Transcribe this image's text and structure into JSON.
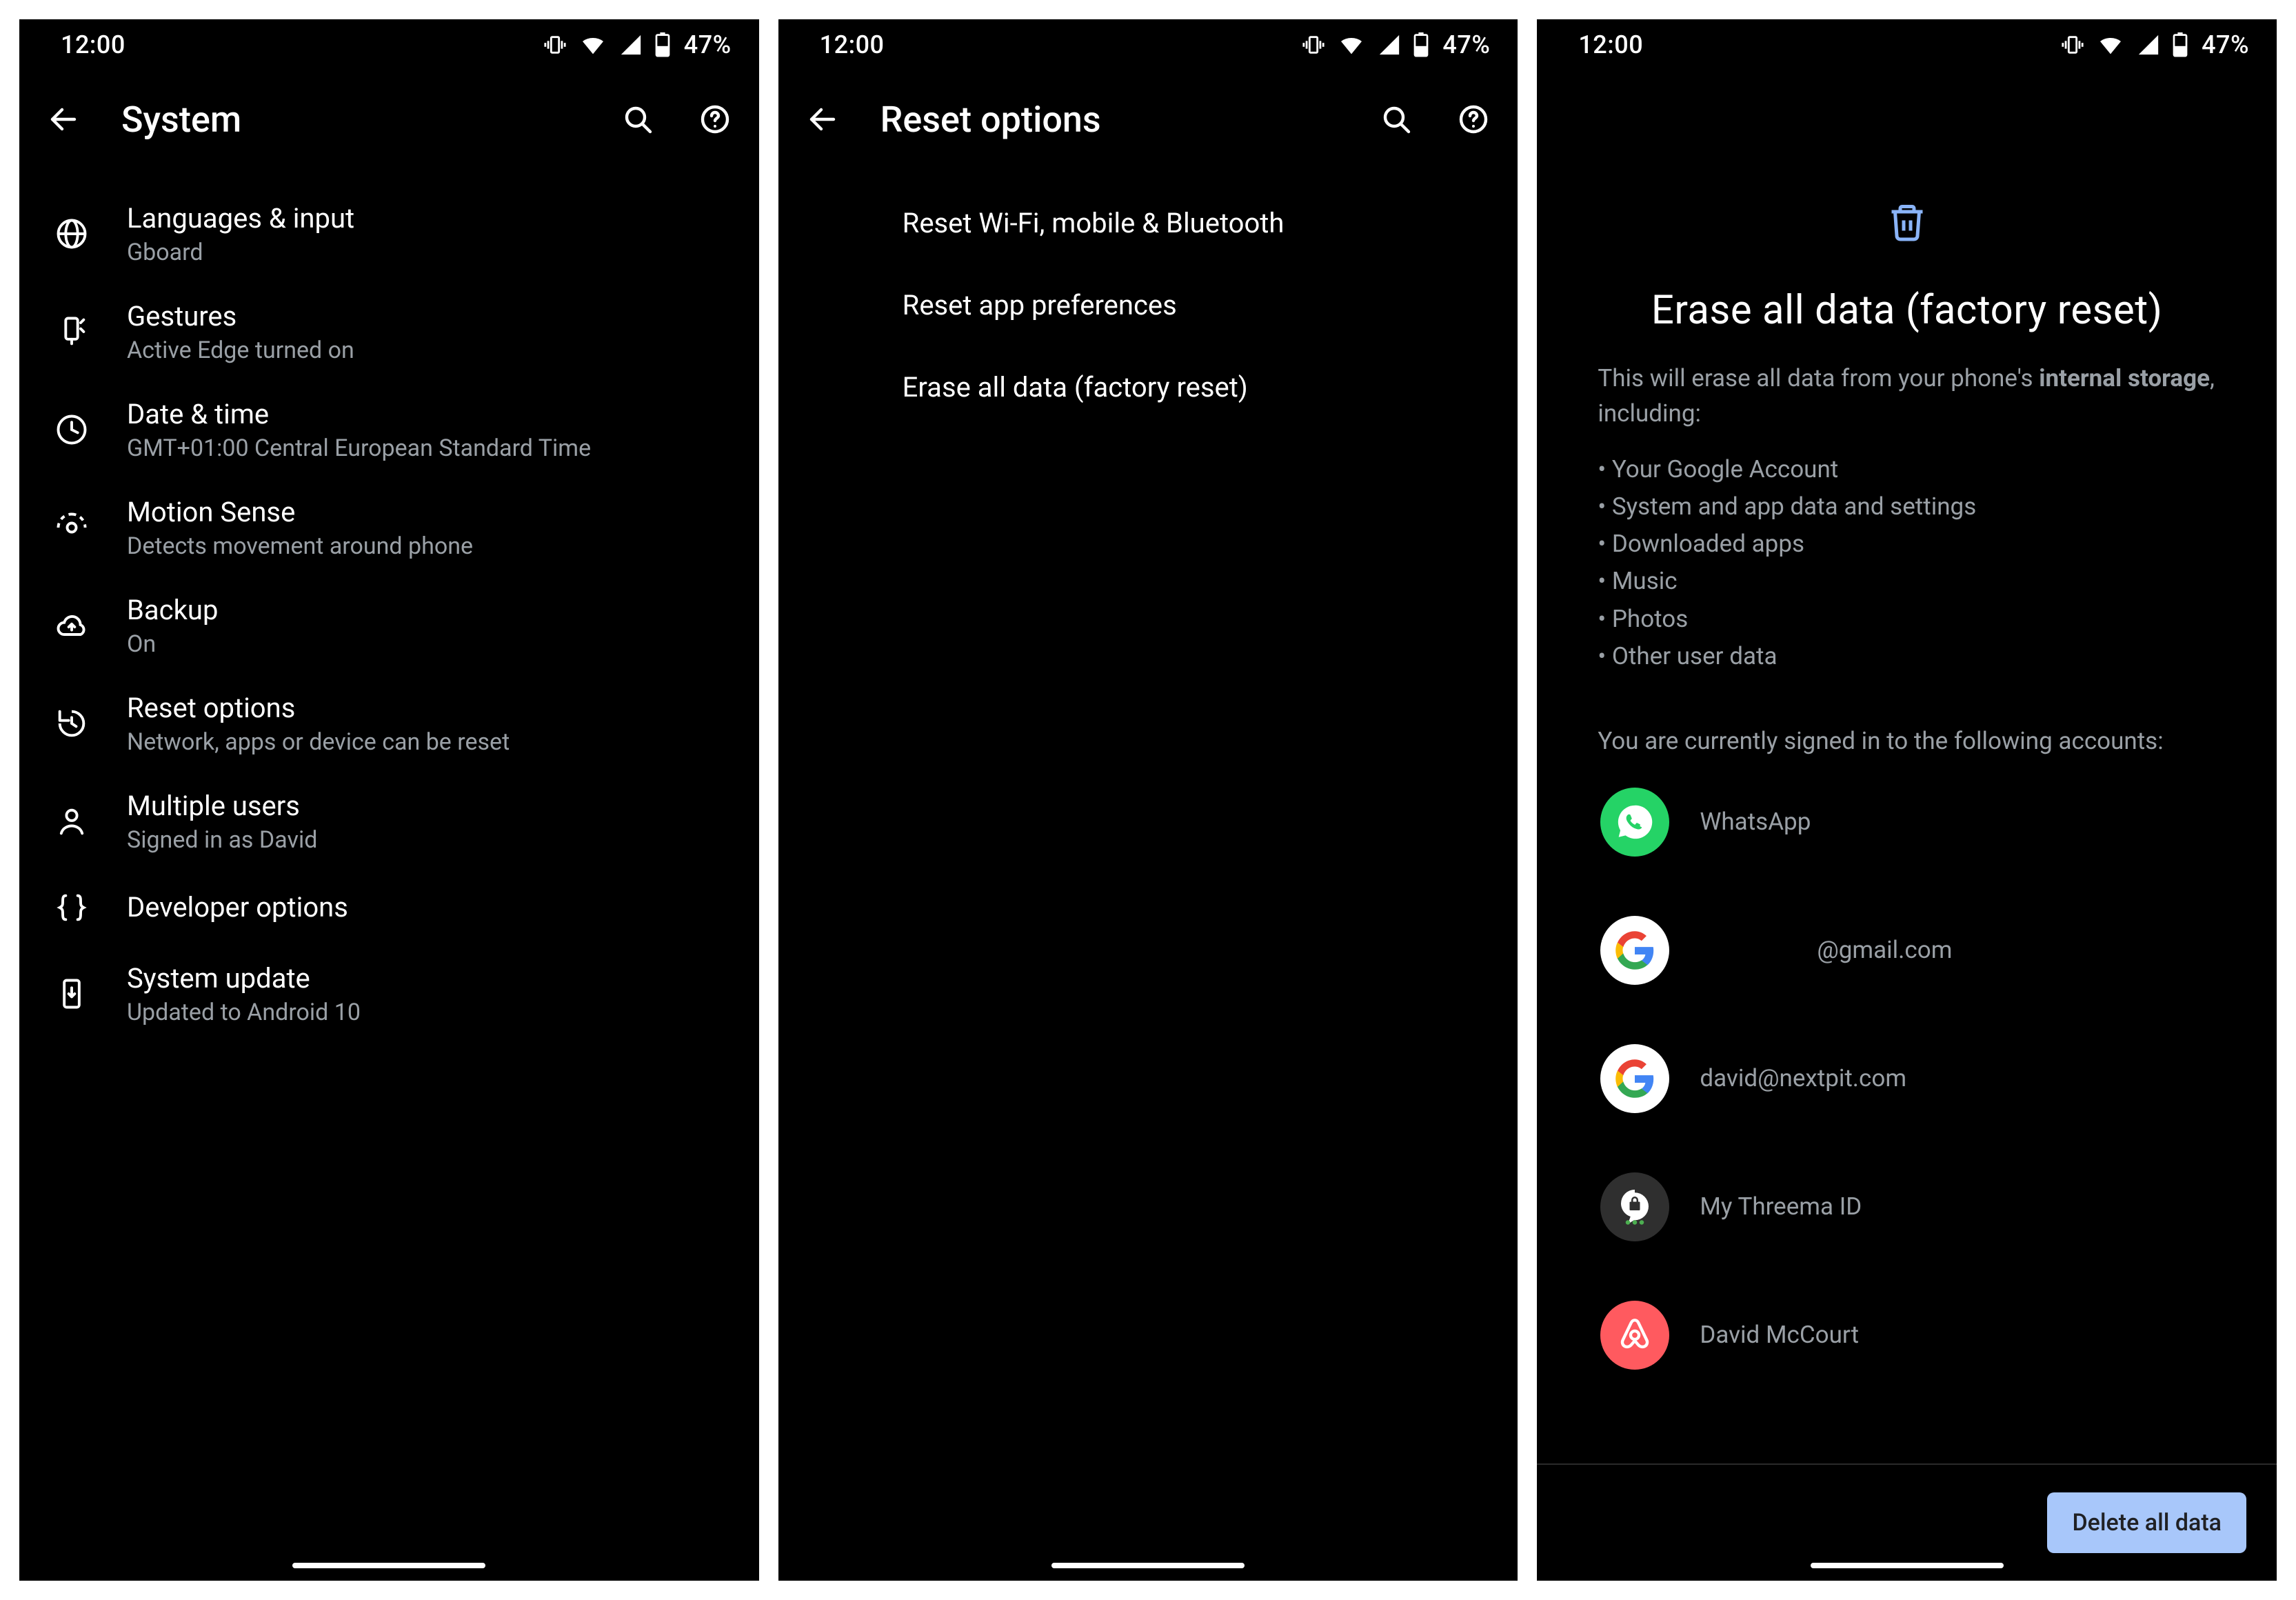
{
  "status": {
    "time": "12:00",
    "battery": "47%"
  },
  "s1": {
    "title": "System",
    "items": [
      {
        "icon": "globe-icon",
        "label": "Languages & input",
        "sub": "Gboard"
      },
      {
        "icon": "gestures-icon",
        "label": "Gestures",
        "sub": "Active Edge turned on"
      },
      {
        "icon": "clock-icon",
        "label": "Date & time",
        "sub": "GMT+01:00 Central European Standard Time"
      },
      {
        "icon": "motion-icon",
        "label": "Motion Sense",
        "sub": "Detects movement around phone"
      },
      {
        "icon": "cloud-icon",
        "label": "Backup",
        "sub": "On"
      },
      {
        "icon": "restore-icon",
        "label": "Reset options",
        "sub": "Network, apps or device can be reset"
      },
      {
        "icon": "user-icon",
        "label": "Multiple users",
        "sub": "Signed in as David"
      },
      {
        "icon": "braces-icon",
        "label": "Developer options",
        "sub": ""
      },
      {
        "icon": "update-icon",
        "label": "System update",
        "sub": "Updated to Android 10"
      }
    ]
  },
  "s2": {
    "title": "Reset options",
    "items": [
      "Reset Wi-Fi, mobile & Bluetooth",
      "Reset app preferences",
      "Erase all data (factory reset)"
    ]
  },
  "s3": {
    "title": "Erase all data (factory reset)",
    "desc_pre": "This will erase all data from your phone's ",
    "desc_bold": "internal storage",
    "desc_post": ", including:",
    "bullets": [
      "Your Google Account",
      "System and app data and settings",
      "Downloaded apps",
      "Music",
      "Photos",
      "Other user data"
    ],
    "signed": "You are currently signed in to the following accounts:",
    "accounts": [
      {
        "icon": "whatsapp-icon",
        "bg": "bg-whatsapp",
        "name": "WhatsApp"
      },
      {
        "icon": "google-icon",
        "bg": "bg-google",
        "name": "@gmail.com"
      },
      {
        "icon": "google-icon",
        "bg": "bg-google",
        "name": "david@nextpit.com"
      },
      {
        "icon": "threema-icon",
        "bg": "bg-threema",
        "name": "My Threema ID"
      },
      {
        "icon": "airbnb-icon",
        "bg": "bg-airbnb",
        "name": "David McCourt"
      }
    ],
    "button": "Delete all data"
  }
}
